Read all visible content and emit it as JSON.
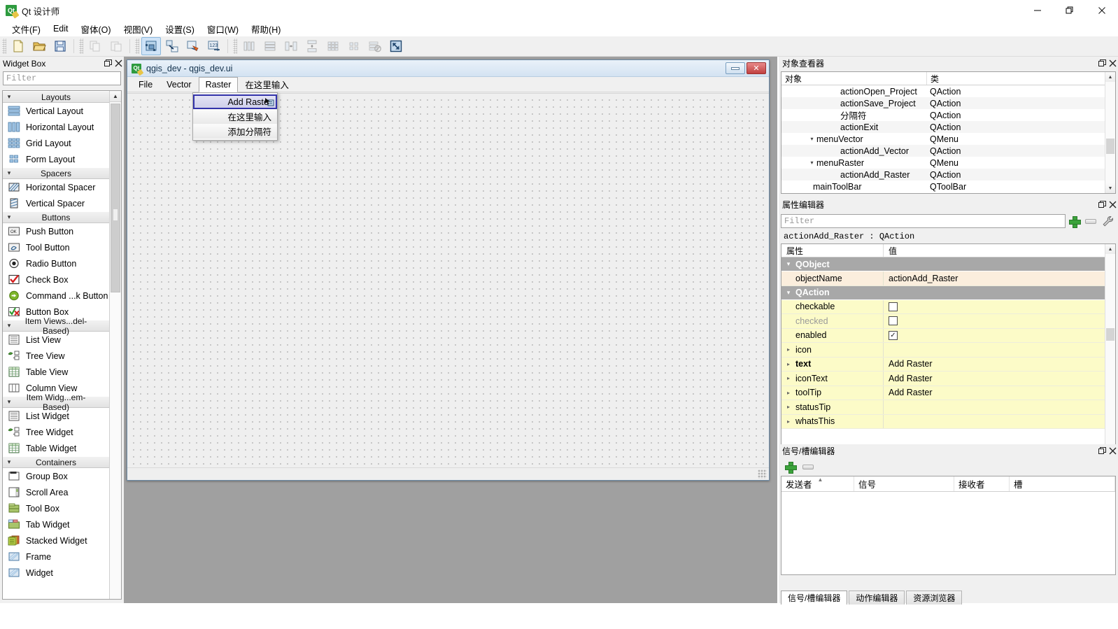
{
  "app": {
    "title": "Qt 设计师",
    "icon": "qt-designer-icon"
  },
  "window_controls": {
    "minimize": "minimize-icon",
    "restore": "restore-icon",
    "close": "close-icon"
  },
  "menubar": {
    "items": [
      {
        "label": "文件(F)"
      },
      {
        "label": "Edit"
      },
      {
        "label": "窗体(O)"
      },
      {
        "label": "视图(V)"
      },
      {
        "label": "设置(S)"
      },
      {
        "label": "窗口(W)"
      },
      {
        "label": "帮助(H)"
      }
    ]
  },
  "toolbar": {
    "groups": [
      {
        "buttons": [
          {
            "name": "new-form-button",
            "icon": "new-file-icon",
            "state": "normal"
          },
          {
            "name": "open-form-button",
            "icon": "open-folder-icon",
            "state": "normal"
          },
          {
            "name": "save-form-button",
            "icon": "save-disk-icon",
            "state": "normal"
          }
        ]
      },
      {
        "buttons": [
          {
            "name": "copy-button",
            "icon": "copy-icon",
            "state": "disabled"
          },
          {
            "name": "paste-button",
            "icon": "paste-icon",
            "state": "disabled"
          }
        ]
      },
      {
        "buttons": [
          {
            "name": "edit-widgets-button",
            "icon": "edit-widgets-icon",
            "state": "active"
          },
          {
            "name": "edit-signals-slots-button",
            "icon": "signals-slots-icon",
            "state": "normal"
          },
          {
            "name": "edit-buddies-button",
            "icon": "buddies-icon",
            "state": "normal"
          },
          {
            "name": "edit-tab-order-button",
            "icon": "tab-order-icon",
            "state": "normal"
          }
        ]
      },
      {
        "buttons": [
          {
            "name": "layout-horizontally-button",
            "icon": "layout-horizontal-icon",
            "state": "disabled"
          },
          {
            "name": "layout-vertically-button",
            "icon": "layout-vertical-icon",
            "state": "disabled"
          },
          {
            "name": "layout-horizontal-splitter-button",
            "icon": "splitter-horizontal-icon",
            "state": "disabled"
          },
          {
            "name": "layout-vertical-splitter-button",
            "icon": "splitter-vertical-icon",
            "state": "disabled"
          },
          {
            "name": "layout-grid-button",
            "icon": "layout-grid-icon",
            "state": "disabled"
          },
          {
            "name": "layout-form-button",
            "icon": "layout-form-icon",
            "state": "disabled"
          },
          {
            "name": "break-layout-button",
            "icon": "break-layout-icon",
            "state": "disabled"
          },
          {
            "name": "adjust-size-button",
            "icon": "adjust-size-icon",
            "state": "normal"
          }
        ]
      }
    ]
  },
  "widget_box": {
    "title": "Widget Box",
    "filter_placeholder": "Filter",
    "dock_buttons": {
      "float": "float-icon",
      "close": "close-icon"
    },
    "categories": [
      {
        "label": "Layouts",
        "expanded": true,
        "items": [
          {
            "label": "Vertical Layout",
            "icon": "vertical-layout-icon"
          },
          {
            "label": "Horizontal Layout",
            "icon": "horizontal-layout-icon"
          },
          {
            "label": "Grid Layout",
            "icon": "grid-layout-icon"
          },
          {
            "label": "Form Layout",
            "icon": "form-layout-icon"
          }
        ]
      },
      {
        "label": "Spacers",
        "expanded": true,
        "items": [
          {
            "label": "Horizontal Spacer",
            "icon": "horizontal-spacer-icon"
          },
          {
            "label": "Vertical Spacer",
            "icon": "vertical-spacer-icon"
          }
        ]
      },
      {
        "label": "Buttons",
        "expanded": true,
        "items": [
          {
            "label": "Push Button",
            "icon": "push-button-icon"
          },
          {
            "label": "Tool Button",
            "icon": "tool-button-icon"
          },
          {
            "label": "Radio Button",
            "icon": "radio-button-icon"
          },
          {
            "label": "Check Box",
            "icon": "check-box-icon"
          },
          {
            "label": "Command ...k Button",
            "icon": "command-link-icon"
          },
          {
            "label": "Button Box",
            "icon": "button-box-icon"
          }
        ]
      },
      {
        "label": "Item Views...del-Based)",
        "expanded": true,
        "items": [
          {
            "label": "List View",
            "icon": "list-view-icon"
          },
          {
            "label": "Tree View",
            "icon": "tree-view-icon"
          },
          {
            "label": "Table View",
            "icon": "table-view-icon"
          },
          {
            "label": "Column View",
            "icon": "column-view-icon"
          }
        ]
      },
      {
        "label": "Item Widg...em-Based)",
        "expanded": true,
        "items": [
          {
            "label": "List Widget",
            "icon": "list-widget-icon"
          },
          {
            "label": "Tree Widget",
            "icon": "tree-widget-icon"
          },
          {
            "label": "Table Widget",
            "icon": "table-widget-icon"
          }
        ]
      },
      {
        "label": "Containers",
        "expanded": true,
        "items": [
          {
            "label": "Group Box",
            "icon": "group-box-icon"
          },
          {
            "label": "Scroll Area",
            "icon": "scroll-area-icon"
          },
          {
            "label": "Tool Box",
            "icon": "tool-box-icon"
          },
          {
            "label": "Tab Widget",
            "icon": "tab-widget-icon"
          },
          {
            "label": "Stacked Widget",
            "icon": "stacked-widget-icon"
          },
          {
            "label": "Frame",
            "icon": "frame-icon"
          },
          {
            "label": "Widget",
            "icon": "widget-icon"
          }
        ]
      }
    ]
  },
  "form_window": {
    "title": "qgis_dev - qgis_dev.ui",
    "icon": "qt-form-icon",
    "buttons": {
      "minimize": "minimize-icon",
      "close": "close-icon"
    },
    "menubar": [
      {
        "label": "File",
        "open": false
      },
      {
        "label": "Vector",
        "open": false
      },
      {
        "label": "Raster",
        "open": true
      },
      {
        "label": "在这里输入",
        "open": false,
        "placeholder": true
      }
    ],
    "open_menu": {
      "parent": "Raster",
      "items": [
        {
          "label": "Add Raster",
          "selected": true,
          "badge": "action-cursor-icon"
        },
        {
          "label": "在这里输入",
          "selected": false
        },
        {
          "label": "添加分隔符",
          "selected": false
        }
      ]
    },
    "sizegrip": "size-grip-icon"
  },
  "object_inspector": {
    "title": "对象查看器",
    "dock_buttons": {
      "float": "float-icon",
      "close": "close-icon"
    },
    "columns": [
      "对象",
      "类"
    ],
    "rows": [
      {
        "name": "actionOpen_Project",
        "class": "QAction",
        "indent": 4,
        "expander": ""
      },
      {
        "name": "actionSave_Project",
        "class": "QAction",
        "indent": 4,
        "expander": ""
      },
      {
        "name": "分隔符",
        "class": "QAction",
        "indent": 4,
        "expander": ""
      },
      {
        "name": "actionExit",
        "class": "QAction",
        "indent": 4,
        "expander": ""
      },
      {
        "name": "menuVector",
        "class": "QMenu",
        "indent": 3,
        "expander": "v"
      },
      {
        "name": "actionAdd_Vector",
        "class": "QAction",
        "indent": 4,
        "expander": ""
      },
      {
        "name": "menuRaster",
        "class": "QMenu",
        "indent": 3,
        "expander": "v"
      },
      {
        "name": "actionAdd_Raster",
        "class": "QAction",
        "indent": 4,
        "expander": ""
      },
      {
        "name": "mainToolBar",
        "class": "QToolBar",
        "indent": 2,
        "expander": ""
      }
    ]
  },
  "property_editor": {
    "title": "属性编辑器",
    "dock_buttons": {
      "float": "float-icon",
      "close": "close-icon"
    },
    "filter_placeholder": "Filter",
    "toolbar": [
      {
        "name": "add-dynamic-property-button",
        "icon": "plus-icon"
      },
      {
        "name": "remove-dynamic-property-button",
        "icon": "minus-icon"
      },
      {
        "name": "configure-property-editor-button",
        "icon": "wrench-icon"
      }
    ],
    "object_line": "actionAdd_Raster : QAction",
    "columns": [
      "属性",
      "值"
    ],
    "rows": [
      {
        "kind": "group",
        "key": "QObject",
        "value": "",
        "expander": "v"
      },
      {
        "kind": "prop",
        "key": "objectName",
        "value": "actionAdd_Raster",
        "style": "cream",
        "expander": ""
      },
      {
        "kind": "group",
        "key": "QAction",
        "value": "",
        "expander": "v"
      },
      {
        "kind": "prop",
        "key": "checkable",
        "value": "",
        "style": "yellow",
        "expander": "",
        "control": "checkbox",
        "checked": false
      },
      {
        "kind": "prop",
        "key": "checked",
        "value": "",
        "style": "yellow dim",
        "expander": "",
        "control": "checkbox",
        "checked": false
      },
      {
        "kind": "prop",
        "key": "enabled",
        "value": "",
        "style": "yellow",
        "expander": "",
        "control": "checkbox",
        "checked": true
      },
      {
        "kind": "prop",
        "key": "icon",
        "value": "",
        "style": "yellow",
        "expander": ">"
      },
      {
        "kind": "prop",
        "key": "text",
        "value": "Add Raster",
        "style": "yellow bold",
        "expander": ">"
      },
      {
        "kind": "prop",
        "key": "iconText",
        "value": "Add Raster",
        "style": "yellow",
        "expander": ">"
      },
      {
        "kind": "prop",
        "key": "toolTip",
        "value": "Add Raster",
        "style": "yellow",
        "expander": ">"
      },
      {
        "kind": "prop",
        "key": "statusTip",
        "value": "",
        "style": "yellow",
        "expander": ">"
      },
      {
        "kind": "prop",
        "key": "whatsThis",
        "value": "",
        "style": "yellow",
        "expander": ">"
      }
    ]
  },
  "signal_slot_editor": {
    "title": "信号/槽编辑器",
    "dock_buttons": {
      "float": "float-icon",
      "close": "close-icon"
    },
    "toolbar": [
      {
        "name": "add-connection-button",
        "icon": "plus-icon"
      },
      {
        "name": "remove-connection-button",
        "icon": "minus-icon"
      }
    ],
    "columns": [
      "发送者",
      "信号",
      "接收者",
      "槽"
    ],
    "rows": [],
    "tabs": [
      {
        "label": "信号/槽编辑器",
        "active": true
      },
      {
        "label": "动作编辑器",
        "active": false
      },
      {
        "label": "资源浏览器",
        "active": false
      }
    ]
  },
  "colors": {
    "accent_blue": "#cfe3f7",
    "selection_border": "#3333aa",
    "group_header": "#a8a8a8",
    "prop_cream": "#fbeedd",
    "prop_yellow": "#fcfbc8",
    "workspace": "#a0a0a0",
    "close_red": "#c04040"
  }
}
